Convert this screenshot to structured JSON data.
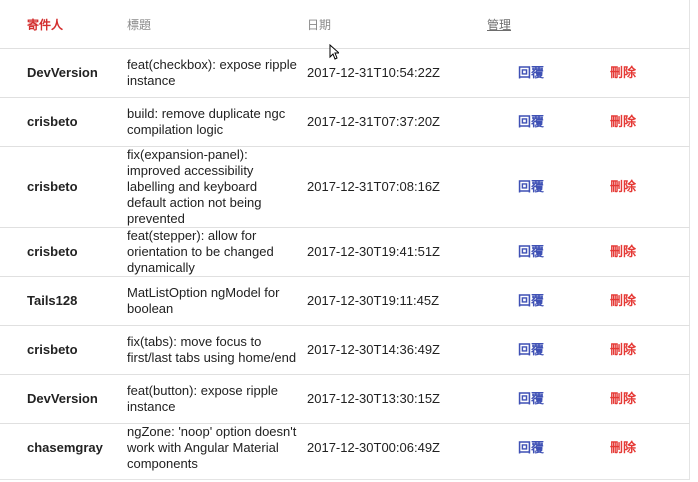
{
  "headers": {
    "sender": "寄件人",
    "title": "標題",
    "date": "日期",
    "manage": "管理"
  },
  "actions": {
    "reply": "回覆",
    "delete": "刪除"
  },
  "rows": [
    {
      "sender": "DevVersion",
      "title": "feat(checkbox): expose ripple instance",
      "date": "2017-12-31T10:54:22Z"
    },
    {
      "sender": "crisbeto",
      "title": "build: remove duplicate ngc compilation logic",
      "date": "2017-12-31T07:37:20Z"
    },
    {
      "sender": "crisbeto",
      "title": "fix(expansion-panel): improved accessibility labelling and keyboard default action not being prevented",
      "date": "2017-12-31T07:08:16Z"
    },
    {
      "sender": "crisbeto",
      "title": "feat(stepper): allow for orientation to be changed dynamically",
      "date": "2017-12-30T19:41:51Z"
    },
    {
      "sender": "Tails128",
      "title": "MatListOption ngModel for boolean",
      "date": "2017-12-30T19:11:45Z"
    },
    {
      "sender": "crisbeto",
      "title": "fix(tabs): move focus to first/last tabs using home/end",
      "date": "2017-12-30T14:36:49Z"
    },
    {
      "sender": "DevVersion",
      "title": "feat(button): expose ripple instance",
      "date": "2017-12-30T13:30:15Z"
    },
    {
      "sender": "chasemgray",
      "title": "ngZone: 'noop' option doesn't work with Angular Material components",
      "date": "2017-12-30T00:06:49Z"
    }
  ]
}
